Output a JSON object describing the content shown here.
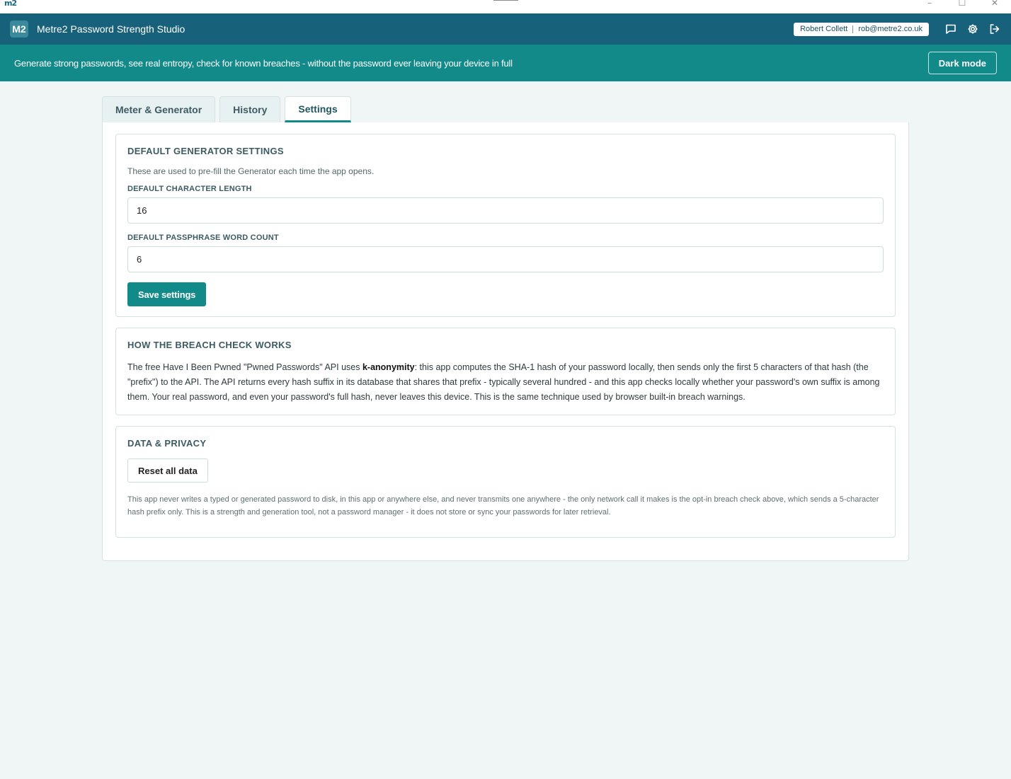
{
  "os": {
    "logo": "m2",
    "controls": [
      "–",
      "☐",
      "✕"
    ]
  },
  "header": {
    "badge": "M2",
    "title": "Metre2 Password Strength Studio",
    "user_name": "Robert Collett",
    "user_email": "rob@metre2.co.uk",
    "icons": [
      "chat-icon",
      "gear-icon",
      "logout-icon"
    ]
  },
  "banner": {
    "text": "Generate strong passwords, see real entropy, check for known breaches - without the password ever leaving your device in full",
    "dark_mode_label": "Dark mode"
  },
  "tabs": [
    {
      "label": "Meter & Generator",
      "active": false
    },
    {
      "label": "History",
      "active": false
    },
    {
      "label": "Settings",
      "active": true
    }
  ],
  "generator_settings": {
    "title": "DEFAULT GENERATOR SETTINGS",
    "subtitle": "These are used to pre-fill the Generator each time the app opens.",
    "length_label": "DEFAULT CHARACTER LENGTH",
    "length_value": "16",
    "wordcount_label": "DEFAULT PASSPHRASE WORD COUNT",
    "wordcount_value": "6",
    "save_label": "Save settings"
  },
  "breach": {
    "title": "HOW THE BREACH CHECK WORKS",
    "text_before": "The free Have I Been Pwned \"Pwned Passwords\" API uses ",
    "text_bold": "k-anonymity",
    "text_after": ": this app computes the SHA-1 hash of your password locally, then sends only the first 5 characters of that hash (the \"prefix\") to the API. The API returns every hash suffix in its database that shares that prefix - typically several hundred - and this app checks locally whether your password's own suffix is among them. Your real password, and even your password's full hash, never leaves this device. This is the same technique used by browser built-in breach warnings."
  },
  "privacy": {
    "title": "DATA & PRIVACY",
    "reset_label": "Reset all data",
    "text": "This app never writes a typed or generated password to disk, in this app or anywhere else, and never transmits one anywhere - the only network call it makes is the opt-in breach check above, which sends a 5-character hash prefix only. This is a strength and generation tool, not a password manager - it does not store or sync your passwords for later retrieval."
  }
}
